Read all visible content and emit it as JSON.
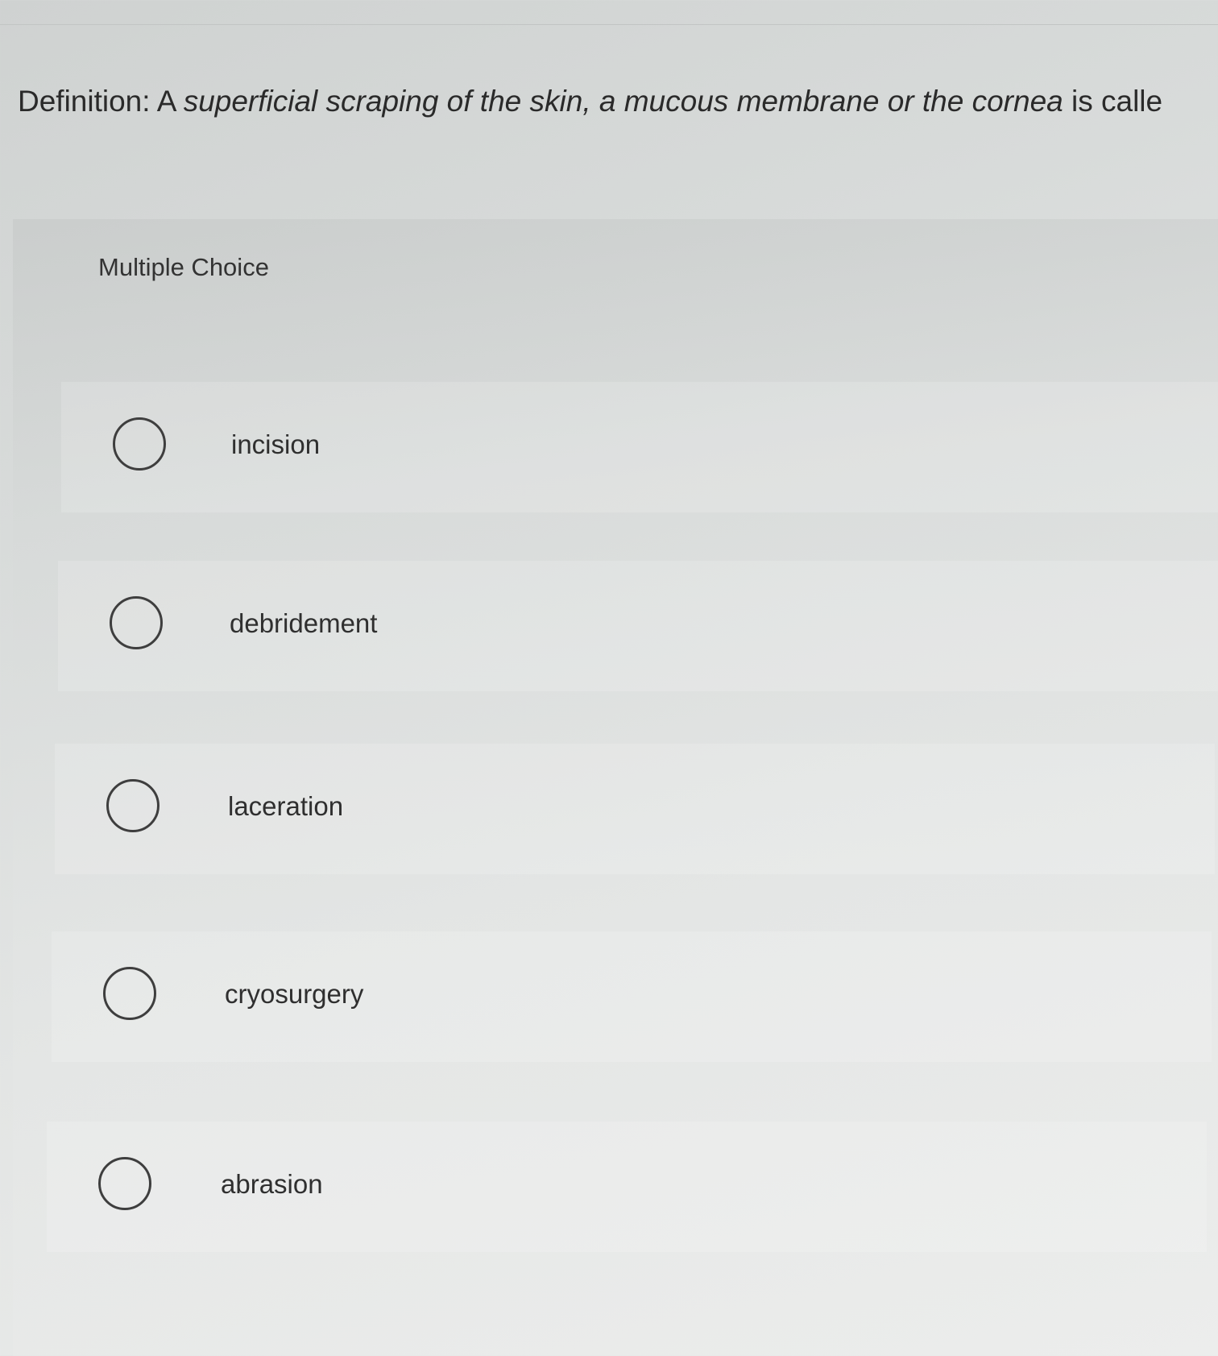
{
  "question": {
    "prefix": "Definition: A ",
    "italic": "superficial scraping of the skin, a mucous membrane or the cornea",
    "suffix": " is calle"
  },
  "question_type": "Multiple Choice",
  "options": [
    {
      "label": "incision",
      "selected": false
    },
    {
      "label": "debridement",
      "selected": false
    },
    {
      "label": "laceration",
      "selected": false
    },
    {
      "label": "cryosurgery",
      "selected": false
    },
    {
      "label": "abrasion",
      "selected": false
    }
  ]
}
